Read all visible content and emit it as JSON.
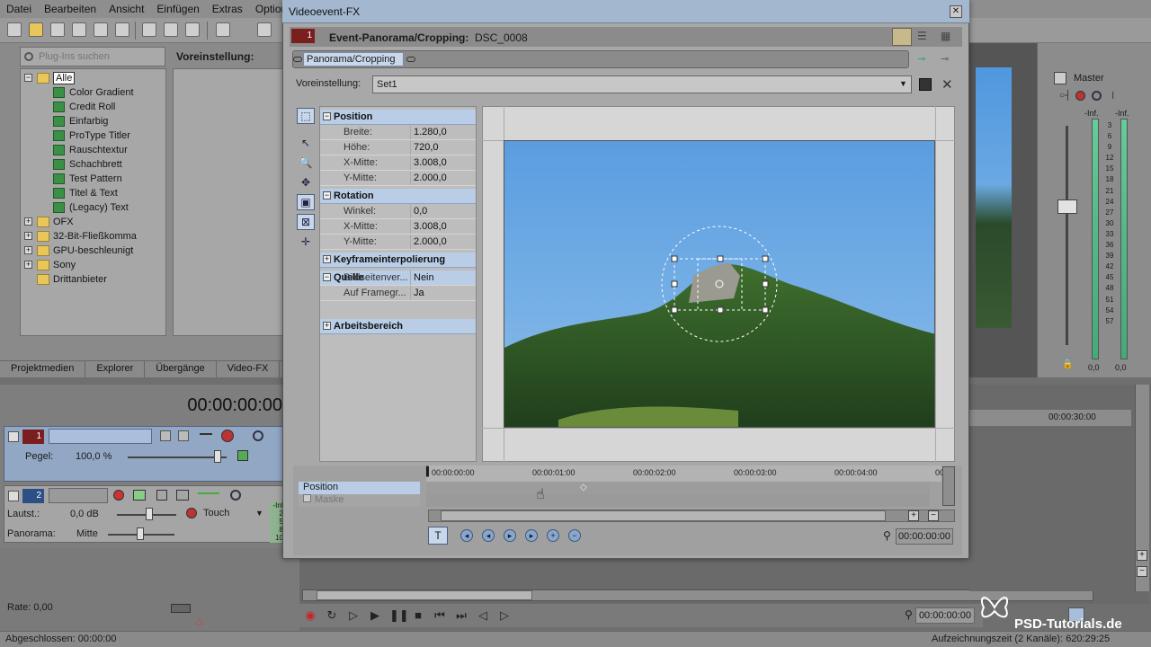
{
  "menubar": [
    "Datei",
    "Bearbeiten",
    "Ansicht",
    "Einfügen",
    "Extras",
    "Option"
  ],
  "left": {
    "search_placeholder": "Plug-Ins suchen",
    "preset_label": "Voreinstellung:",
    "tree": [
      {
        "label": "Alle",
        "level": 0,
        "type": "folder",
        "expanded": true,
        "selected": true
      },
      {
        "label": "Color Gradient",
        "level": 1,
        "type": "plugin"
      },
      {
        "label": "Credit Roll",
        "level": 1,
        "type": "plugin"
      },
      {
        "label": "Einfarbig",
        "level": 1,
        "type": "plugin"
      },
      {
        "label": "ProType Titler",
        "level": 1,
        "type": "plugin"
      },
      {
        "label": "Rauschtextur",
        "level": 1,
        "type": "plugin"
      },
      {
        "label": "Schachbrett",
        "level": 1,
        "type": "plugin"
      },
      {
        "label": "Test Pattern",
        "level": 1,
        "type": "plugin"
      },
      {
        "label": "Titel & Text",
        "level": 1,
        "type": "plugin"
      },
      {
        "label": "(Legacy) Text",
        "level": 1,
        "type": "plugin"
      },
      {
        "label": "OFX",
        "level": 0,
        "type": "folder"
      },
      {
        "label": "32-Bit-Fließkomma",
        "level": 0,
        "type": "folder"
      },
      {
        "label": "GPU-beschleunigt",
        "level": 0,
        "type": "folder"
      },
      {
        "label": "Sony",
        "level": 0,
        "type": "folder"
      },
      {
        "label": "Drittanbieter",
        "level": 0,
        "type": "folder",
        "no_expander": true
      }
    ],
    "tabs": [
      "Projektmedien",
      "Explorer",
      "Übergänge",
      "Video-FX"
    ]
  },
  "tracks": {
    "timecode": "00:00:00:00",
    "track1_num": "1",
    "pegel_label": "Pegel:",
    "pegel_value": "100,0 %",
    "track2_num": "2",
    "lautst_label": "Lautst.:",
    "lautst_value": "0,0 dB",
    "touch_label": "Touch",
    "panorama_label": "Panorama:",
    "panorama_value": "Mitte",
    "meter_mini": [
      "-Inf",
      "2",
      "5",
      "8",
      "10"
    ]
  },
  "bottom": {
    "rate": "Rate: 0,00",
    "status": "Abgeschlossen: 00:00:00",
    "record_time": "Aufzeichnungszeit (2 Kanäle): 620:29:25",
    "timecode": "00:00:00:00"
  },
  "master": {
    "label": "Master",
    "inf_left": "-Inf.",
    "inf_right": "-Inf.",
    "scale": [
      "3",
      "6",
      "9",
      "12",
      "15",
      "18",
      "21",
      "24",
      "27",
      "30",
      "33",
      "36",
      "39",
      "42",
      "45",
      "48",
      "51",
      "54",
      "57"
    ],
    "val_left": "0,0",
    "val_right": "0,0",
    "ruler_label": "00:00:30:00"
  },
  "dialog": {
    "title": "Videoevent-FX",
    "event_num": "1",
    "event_label": "Event-Panorama/Cropping:",
    "event_name": "DSC_0008",
    "chain_item": "Panorama/Cropping",
    "preset_label": "Voreinstellung:",
    "preset_value": "Set1",
    "sections": [
      {
        "title": "Position",
        "expanded": true,
        "rows": [
          [
            "Breite:",
            "1.280,0"
          ],
          [
            "Höhe:",
            "720,0"
          ],
          [
            "X-Mitte:",
            "3.008,0"
          ],
          [
            "Y-Mitte:",
            "2.000,0"
          ]
        ]
      },
      {
        "title": "Rotation",
        "expanded": true,
        "rows": [
          [
            "Winkel:",
            "0,0"
          ],
          [
            "X-Mitte:",
            "3.008,0"
          ],
          [
            "Y-Mitte:",
            "2.000,0"
          ]
        ]
      },
      {
        "title": "Keyframeinterpolierung",
        "expanded": false,
        "rows": []
      },
      {
        "title": "Quelle",
        "expanded": true,
        "rows": [
          [
            "Bildseitenver...",
            "Nein"
          ],
          [
            "Auf Framegr...",
            "Ja"
          ]
        ]
      },
      {
        "title": "Arbeitsbereich",
        "expanded": false,
        "rows": []
      }
    ],
    "kf_ruler": [
      "00:00:00:00",
      "00:00:01:00",
      "00:00:02:00",
      "00:00:03:00",
      "00:00:04:00",
      "00:"
    ],
    "kf_rows": [
      "Position",
      "Maske"
    ],
    "kf_timecode": "00:00:00:00"
  },
  "watermark": "PSD-Tutorials.de"
}
